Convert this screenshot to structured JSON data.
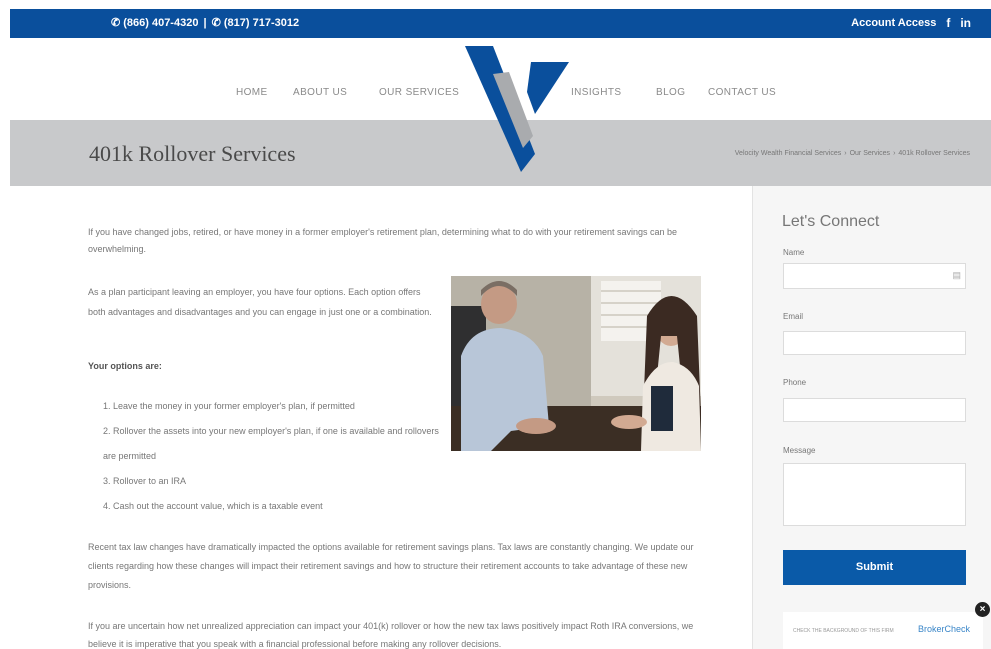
{
  "topbar": {
    "phone1": "(866) 407-4320",
    "phone2": "(817) 717-3012",
    "account_access": "Account Access",
    "facebook": "f",
    "linkedin": "in"
  },
  "nav": {
    "items": [
      "HOME",
      "ABOUT US",
      "OUR SERVICES",
      "INSIGHTS",
      "BLOG",
      "CONTACT US"
    ]
  },
  "page": {
    "title": "401k Rollover Services",
    "breadcrumb": [
      "Velocity Wealth Financial Services",
      "Our Services",
      "401k Rollover Services"
    ]
  },
  "content": {
    "p1": "If you have changed jobs, retired, or have money in a former employer's retirement plan, determining what to do with your retirement savings can be overwhelming.",
    "p2": "As a plan participant leaving an employer, you have four options. Each option offers both advantages and disadvantages and you can engage in just one or a combination.",
    "options_heading": "Your options are:",
    "options": [
      "1.  Leave the money in your former employer's plan, if permitted",
      "2.  Rollover the assets into your new employer's plan, if one is available and rollovers are permitted",
      "3.  Rollover to an IRA",
      "4.  Cash out the account value, which is a taxable event"
    ],
    "p3": "Recent tax law changes have dramatically impacted the options available for retirement savings plans. Tax laws are constantly changing. We update our clients regarding how these changes will impact their retirement savings and how to structure their retirement accounts to take advantage of these new provisions.",
    "p4": "If you are uncertain how net unrealized appreciation can impact your 401(k) rollover or how the new tax laws positively impact Roth IRA conversions, we believe it is imperative that you speak with a financial professional before making any rollover decisions."
  },
  "form": {
    "heading": "Let's Connect",
    "name_label": "Name",
    "email_label": "Email",
    "phone_label": "Phone",
    "message_label": "Message",
    "submit_label": "Submit"
  },
  "brokercheck": {
    "text": "CHECK THE BACKGROUND OF THIS FIRM",
    "logo": "BrokerCheck"
  },
  "colors": {
    "brand_blue": "#0a4f9c",
    "button_blue": "#0a5aa8",
    "title_bar_gray": "#c8c9cb"
  }
}
